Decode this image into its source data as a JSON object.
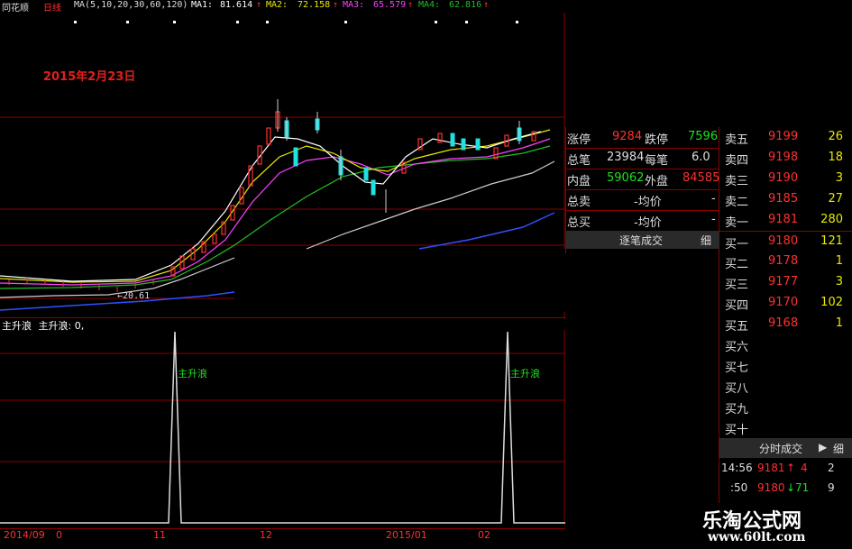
{
  "app": {
    "name": "同花顺",
    "period": "日线"
  },
  "ma_header": {
    "params": "MA(5,10,20,30,60,120)",
    "ma1": {
      "label": "MA1:",
      "value": "81.614",
      "arrow": "↑"
    },
    "ma2": {
      "label": "MA2:",
      "value": "72.158",
      "arrow": "↑"
    },
    "ma3": {
      "label": "MA3:",
      "value": "65.579",
      "arrow": "↑"
    },
    "ma4": {
      "label": "MA4:",
      "value": "62.816",
      "arrow": "↑"
    }
  },
  "annotation": {
    "date": "2015年2月23日",
    "low_price": "20.61"
  },
  "indicator": {
    "name": "主升浪",
    "line": "主升浪: 0,",
    "signal_label_1": "主升浪",
    "signal_label_2": "主升浪"
  },
  "time_axis": [
    "2014/09",
    "0",
    "11",
    "12",
    "2015/01",
    "02"
  ],
  "stats": {
    "zhangting_label": "涨停",
    "zhangting_value": "9284",
    "dieting_label": "跌停",
    "dieting_value": "7596",
    "zongbi_label": "总笔",
    "zongbi_value": "23984",
    "meibi_label": "每笔",
    "meibi_value": "6.0",
    "neipan_label": "内盘",
    "neipan_value": "59062",
    "waipan_label": "外盘",
    "waipan_value": "84585",
    "zongmai_label": "总卖",
    "zongmai_avg": "-均价",
    "zongmai_value": "-",
    "zongmaib_label": "总买",
    "zongmaib_avg": "-均价",
    "zongmaib_value": "-"
  },
  "buttons": {
    "zhubi": "逐笔成交",
    "xi": "细",
    "fenshi": "分时成交",
    "play": "▶",
    "xi2": "细"
  },
  "order_book": [
    {
      "label": "卖五",
      "price": "9199",
      "vol": "26"
    },
    {
      "label": "卖四",
      "price": "9198",
      "vol": "18"
    },
    {
      "label": "卖三",
      "price": "9190",
      "vol": "3"
    },
    {
      "label": "卖二",
      "price": "9185",
      "vol": "27"
    },
    {
      "label": "卖一",
      "price": "9181",
      "vol": "280"
    },
    {
      "label": "买一",
      "price": "9180",
      "vol": "121"
    },
    {
      "label": "买二",
      "price": "9178",
      "vol": "1"
    },
    {
      "label": "买三",
      "price": "9177",
      "vol": "3"
    },
    {
      "label": "买四",
      "price": "9170",
      "vol": "102"
    },
    {
      "label": "买五",
      "price": "9168",
      "vol": "1"
    },
    {
      "label": "买六",
      "price": "",
      "vol": ""
    },
    {
      "label": "买七",
      "price": "",
      "vol": ""
    },
    {
      "label": "买八",
      "price": "",
      "vol": ""
    },
    {
      "label": "买九",
      "price": "",
      "vol": ""
    },
    {
      "label": "买十",
      "price": "",
      "vol": ""
    }
  ],
  "ticks": [
    {
      "time": "14:56",
      "price": "9181",
      "arrow": "↑",
      "vol": "4",
      "flag": "2"
    },
    {
      "time": ":50",
      "price": "9180",
      "arrow": "↓",
      "vol": "71",
      "flag": "9"
    }
  ],
  "watermark": {
    "title": "乐淘公式网",
    "url": "www.60lt.com"
  },
  "colors": {
    "up": "#ff3030",
    "down": "#20e020",
    "grid": "#8b0000",
    "ma1": "#ffffff",
    "ma2": "#e8e800",
    "ma3": "#ff40ff",
    "ma4": "#20c020",
    "ma5": "#ffffff",
    "ma6": "#3050ff"
  }
}
